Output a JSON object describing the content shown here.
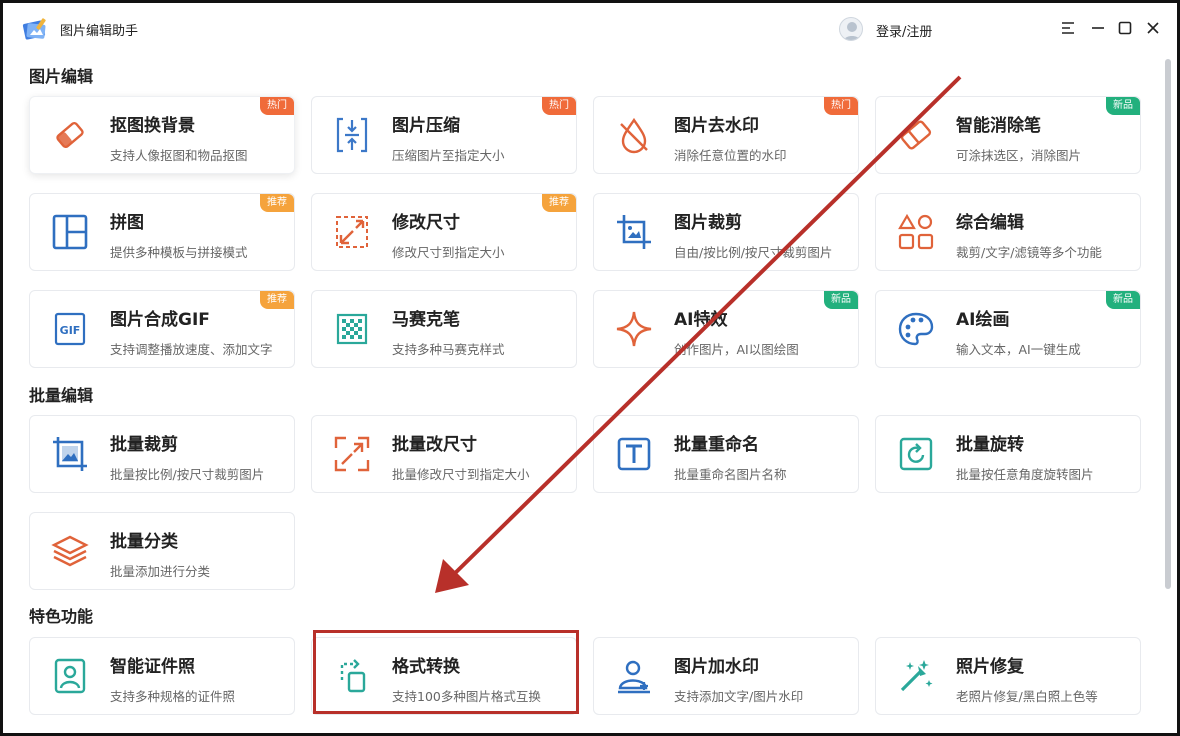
{
  "app": {
    "title": "图片编辑助手",
    "login": "登录/注册"
  },
  "sections": [
    {
      "title": "图片编辑"
    },
    {
      "title": "批量编辑"
    },
    {
      "title": "特色功能"
    }
  ],
  "cards": [
    {
      "name": "抠图换背景",
      "desc": "支持人像抠图和物品抠图",
      "badge": "热门",
      "icon": "eraser-icon"
    },
    {
      "name": "图片压缩",
      "desc": "压缩图片至指定大小",
      "badge": "热门",
      "icon": "compress-icon"
    },
    {
      "name": "图片去水印",
      "desc": "消除任意位置的水印",
      "badge": "热门",
      "icon": "no-drop-icon"
    },
    {
      "name": "智能消除笔",
      "desc": "可涂抹选区，消除图片",
      "badge": "新品",
      "icon": "eraser-outline-icon"
    },
    {
      "name": "拼图",
      "desc": "提供多种模板与拼接模式",
      "badge": "推荐",
      "icon": "layout-icon"
    },
    {
      "name": "修改尺寸",
      "desc": "修改尺寸到指定大小",
      "badge": "推荐",
      "icon": "resize-icon"
    },
    {
      "name": "图片裁剪",
      "desc": "自由/按比例/按尺寸裁剪图片",
      "badge": "",
      "icon": "crop-icon"
    },
    {
      "name": "综合编辑",
      "desc": "裁剪/文字/滤镜等多个功能",
      "badge": "",
      "icon": "shapes-icon"
    },
    {
      "name": "图片合成GIF",
      "desc": "支持调整播放速度、添加文字",
      "badge": "推荐",
      "icon": "gif-icon"
    },
    {
      "name": "马赛克笔",
      "desc": "支持多种马赛克样式",
      "badge": "",
      "icon": "mosaic-icon"
    },
    {
      "name": "AI特效",
      "desc": "创作图片，AI以图绘图",
      "badge": "新品",
      "icon": "sparkle-icon"
    },
    {
      "name": "AI绘画",
      "desc": "输入文本，AI一键生成",
      "badge": "新品",
      "icon": "palette-icon"
    },
    {
      "name": "批量裁剪",
      "desc": "批量按比例/按尺寸裁剪图片",
      "badge": "",
      "icon": "crop-image-icon"
    },
    {
      "name": "批量改尺寸",
      "desc": "批量修改尺寸到指定大小",
      "badge": "",
      "icon": "expand-icon"
    },
    {
      "name": "批量重命名",
      "desc": "批量重命名图片名称",
      "badge": "",
      "icon": "text-box-icon"
    },
    {
      "name": "批量旋转",
      "desc": "批量按任意角度旋转图片",
      "badge": "",
      "icon": "rotate-icon"
    },
    {
      "name": "批量分类",
      "desc": "批量添加进行分类",
      "badge": "",
      "icon": "layers-icon"
    },
    {
      "name": "智能证件照",
      "desc": "支持多种规格的证件照",
      "badge": "",
      "icon": "id-photo-icon"
    },
    {
      "name": "格式转换",
      "desc": "支持100多种图片格式互换",
      "badge": "",
      "icon": "convert-icon"
    },
    {
      "name": "图片加水印",
      "desc": "支持添加文字/图片水印",
      "badge": "",
      "icon": "watermark-icon"
    },
    {
      "name": "照片修复",
      "desc": "老照片修复/黑白照上色等",
      "badge": "",
      "icon": "magic-wand-icon"
    }
  ],
  "colors": {
    "hot": "#f06b3a",
    "recommend": "#f5a33c",
    "new": "#22b07d",
    "highlight": "#b8302a",
    "arrow": "#b8302a"
  }
}
